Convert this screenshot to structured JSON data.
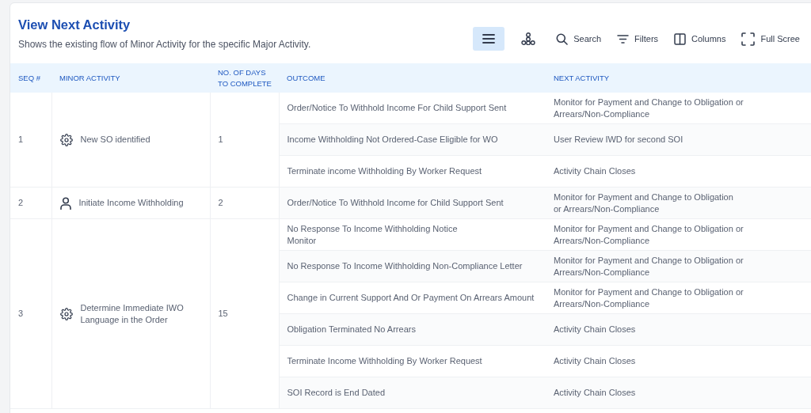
{
  "header": {
    "title": "View Next Activity",
    "subtitle": "Shows the existing flow of Minor Activity for the specific Major Activity."
  },
  "toolbar": [
    {
      "kind": "list",
      "selected": true
    },
    {
      "kind": "tree",
      "selected": false
    },
    {
      "kind": "search",
      "label": "Search",
      "selected": false
    },
    {
      "kind": "filters",
      "label": "Filters",
      "selected": false
    },
    {
      "kind": "columns",
      "label": "Columns",
      "selected": false
    },
    {
      "kind": "fullscreen",
      "label": "Full Scree",
      "selected": false
    }
  ],
  "table": {
    "columns": [
      "SEQ #",
      "MINOR ACTIVITY",
      "NO. OF DAYS\nTO COMPLETE",
      "OUTCOME",
      "NEXT ACTIVITY"
    ],
    "rows": [
      {
        "seq": "1",
        "kind": "gear",
        "minor_activity": "New SO identified",
        "days": "1",
        "outcomes": [
          {
            "outcome": "Order/Notice To Withhold Income For Child Support Sent",
            "next_activity": "Monitor for Payment and Change to Obligation or\n Arrears/Non-Compliance"
          },
          {
            "outcome": "Income Withholding Not Ordered-Case Eligible for WO",
            "next_activity": "User Review IWD for second SOI"
          },
          {
            "outcome": "Terminate income Withholding By Worker Request",
            "next_activity": "Activity Chain Closes"
          }
        ]
      },
      {
        "seq": "2",
        "kind": "person",
        "minor_activity": "Initiate Income Withholding",
        "days": "2",
        "outcomes": [
          {
            "outcome": "Order/Notice To Withhold Income for Child Support Sent",
            "next_activity": "Monitor for Payment and Change to Obligation\nor Arrears/Non-Compliance"
          }
        ]
      },
      {
        "seq": "3",
        "kind": "gear",
        "minor_activity": "Determine Immediate IWO\n Language in the Order",
        "days": "15",
        "outcomes": [
          {
            "outcome": "No Response To Income Withholding Notice\nMonitor",
            "next_activity": "Monitor for Payment and Change to Obligation or\n Arrears/Non-Compliance"
          },
          {
            "outcome": "No Response To Income Withholding Non-Compliance Letter",
            "next_activity": "Monitor for Payment and Change to Obligation or\n Arrears/Non-Compliance"
          },
          {
            "outcome": "Change in Current Support And Or Payment On Arrears Amount",
            "next_activity": "Monitor for Payment and Change to Obligation or\n Arrears/Non-Compliance"
          },
          {
            "outcome": "Obligation Terminated No Arrears",
            "next_activity": "Activity Chain Closes"
          },
          {
            "outcome": "Terminate Income Withholding By Worker Request",
            "next_activity": "Activity Chain Closes"
          },
          {
            "outcome": "SOI Record is End Dated",
            "next_activity": "Activity Chain Closes"
          }
        ]
      }
    ]
  }
}
